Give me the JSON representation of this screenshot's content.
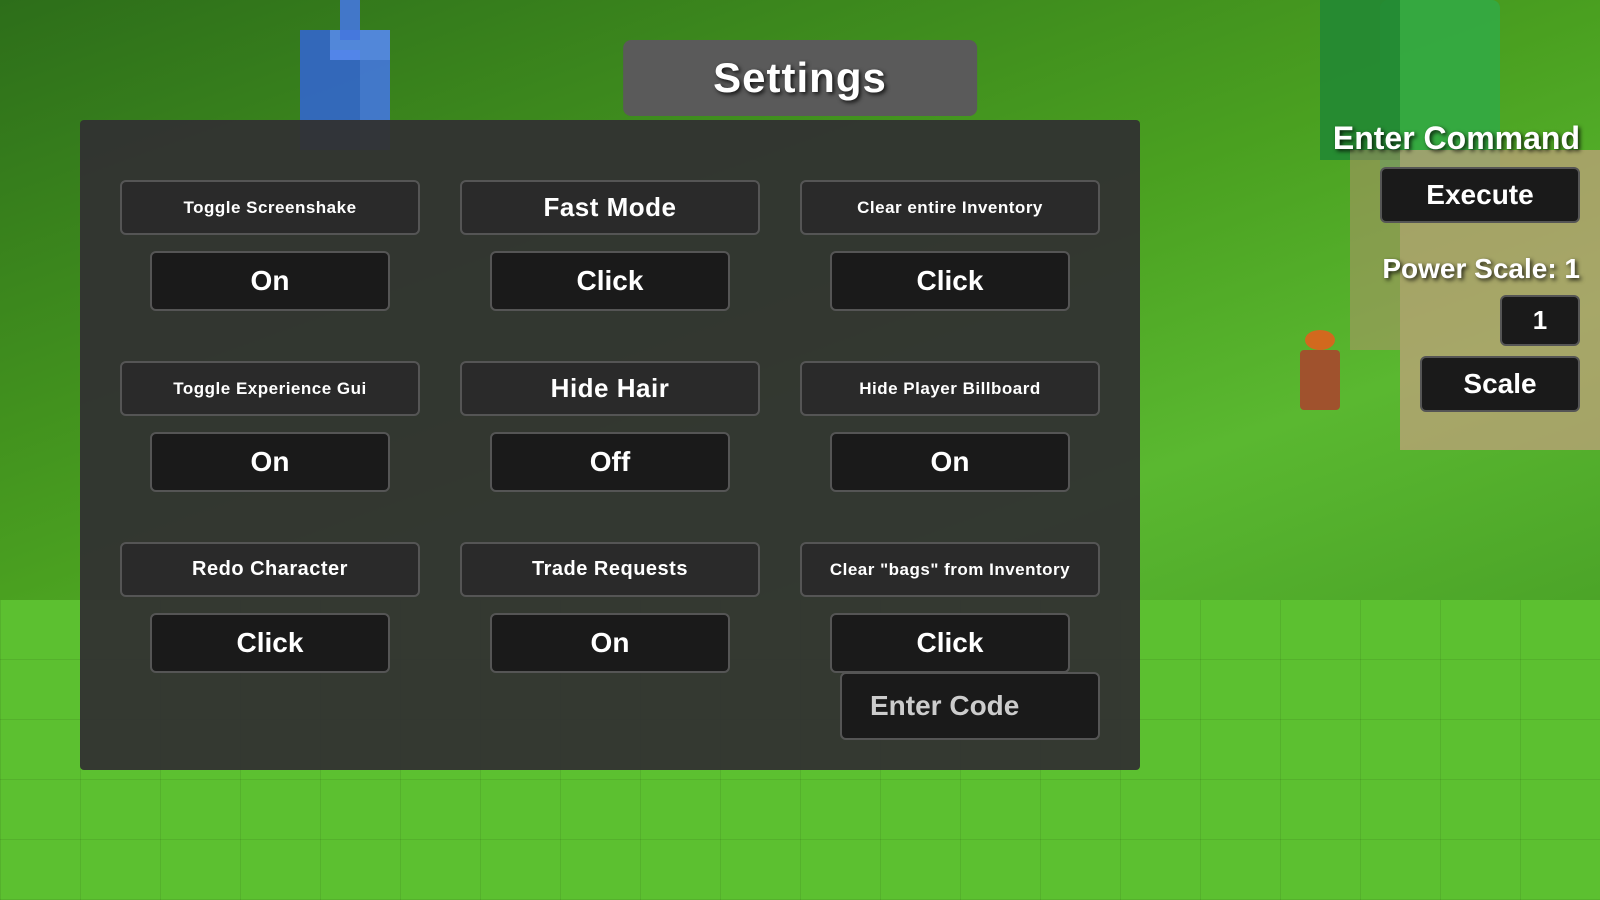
{
  "title": "Settings",
  "settings": {
    "row1": [
      {
        "label": "Toggle Screenshake",
        "value": "On",
        "label_size": "small",
        "id": "toggle-screenshake"
      },
      {
        "label": "Fast Mode",
        "value": "Click",
        "label_size": "large",
        "id": "fast-mode"
      },
      {
        "label": "Clear entire Inventory",
        "value": "Click",
        "label_size": "small",
        "id": "clear-inventory"
      }
    ],
    "row2": [
      {
        "label": "Toggle Experience Gui",
        "value": "On",
        "label_size": "small",
        "id": "toggle-experience-gui"
      },
      {
        "label": "Hide Hair",
        "value": "Off",
        "label_size": "large",
        "id": "hide-hair"
      },
      {
        "label": "Hide Player Billboard",
        "value": "On",
        "label_size": "small",
        "id": "hide-player-billboard"
      }
    ],
    "row3": [
      {
        "label": "Redo Character",
        "value": "Click",
        "label_size": "medium",
        "id": "redo-character"
      },
      {
        "label": "Trade Requests",
        "value": "On",
        "label_size": "medium",
        "id": "trade-requests"
      },
      {
        "label": "Clear \"bags\" from Inventory",
        "value": "Click",
        "label_size": "small",
        "id": "clear-bags-inventory"
      }
    ]
  },
  "enter_code_placeholder": "Enter Code",
  "right_panel": {
    "enter_command_label": "Enter Command",
    "execute_label": "Execute",
    "power_scale_label": "Power Scale: 1",
    "scale_value": "1",
    "scale_button": "Scale"
  }
}
